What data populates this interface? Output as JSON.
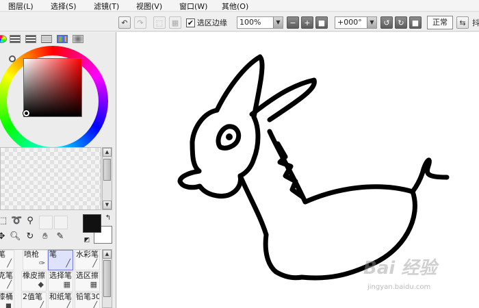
{
  "menu": [
    {
      "label": "图层(L)",
      "name": "menu-layer"
    },
    {
      "label": "选择(S)",
      "name": "menu-select"
    },
    {
      "label": "滤镜(T)",
      "name": "menu-filter"
    },
    {
      "label": "视图(V)",
      "name": "menu-view"
    },
    {
      "label": "窗口(W)",
      "name": "menu-window"
    },
    {
      "label": "其他(O)",
      "name": "menu-other"
    }
  ],
  "toolbar": {
    "select_edge_label": "选区边缘",
    "select_edge_checked": true,
    "zoom_value": "100%",
    "rotation_value": "+000°",
    "blend_mode_label": "正常",
    "cut_off_glyph": "抖"
  },
  "colors": {
    "main": "#111111",
    "sub": "#ffffff",
    "brush_active_bg": "#dfe2fb"
  },
  "brushes": [
    {
      "label": "钢笔",
      "icon": "pen-icon"
    },
    {
      "label": "喷枪",
      "icon": "airbrush-icon"
    },
    {
      "label": "笔",
      "icon": "brush-icon",
      "active": true
    },
    {
      "label": "水彩笔",
      "icon": "watercolor-icon"
    },
    {
      "label": "马克笔",
      "icon": "marker-icon"
    },
    {
      "label": "橡皮擦",
      "icon": "eraser-icon"
    },
    {
      "label": "选择笔",
      "icon": "select-pen-icon"
    },
    {
      "label": "选区擦",
      "icon": "select-eraser-icon"
    },
    {
      "label": "油漆桶",
      "icon": "bucket-icon"
    },
    {
      "label": "2值笔",
      "icon": "binary-pen-icon"
    },
    {
      "label": "和纸笔",
      "icon": "washi-pen-icon"
    },
    {
      "label": "铅笔30",
      "icon": "pencil-icon"
    }
  ],
  "watermark": {
    "brand": "Bai  经验",
    "url": "jingyan.baidu.com"
  }
}
